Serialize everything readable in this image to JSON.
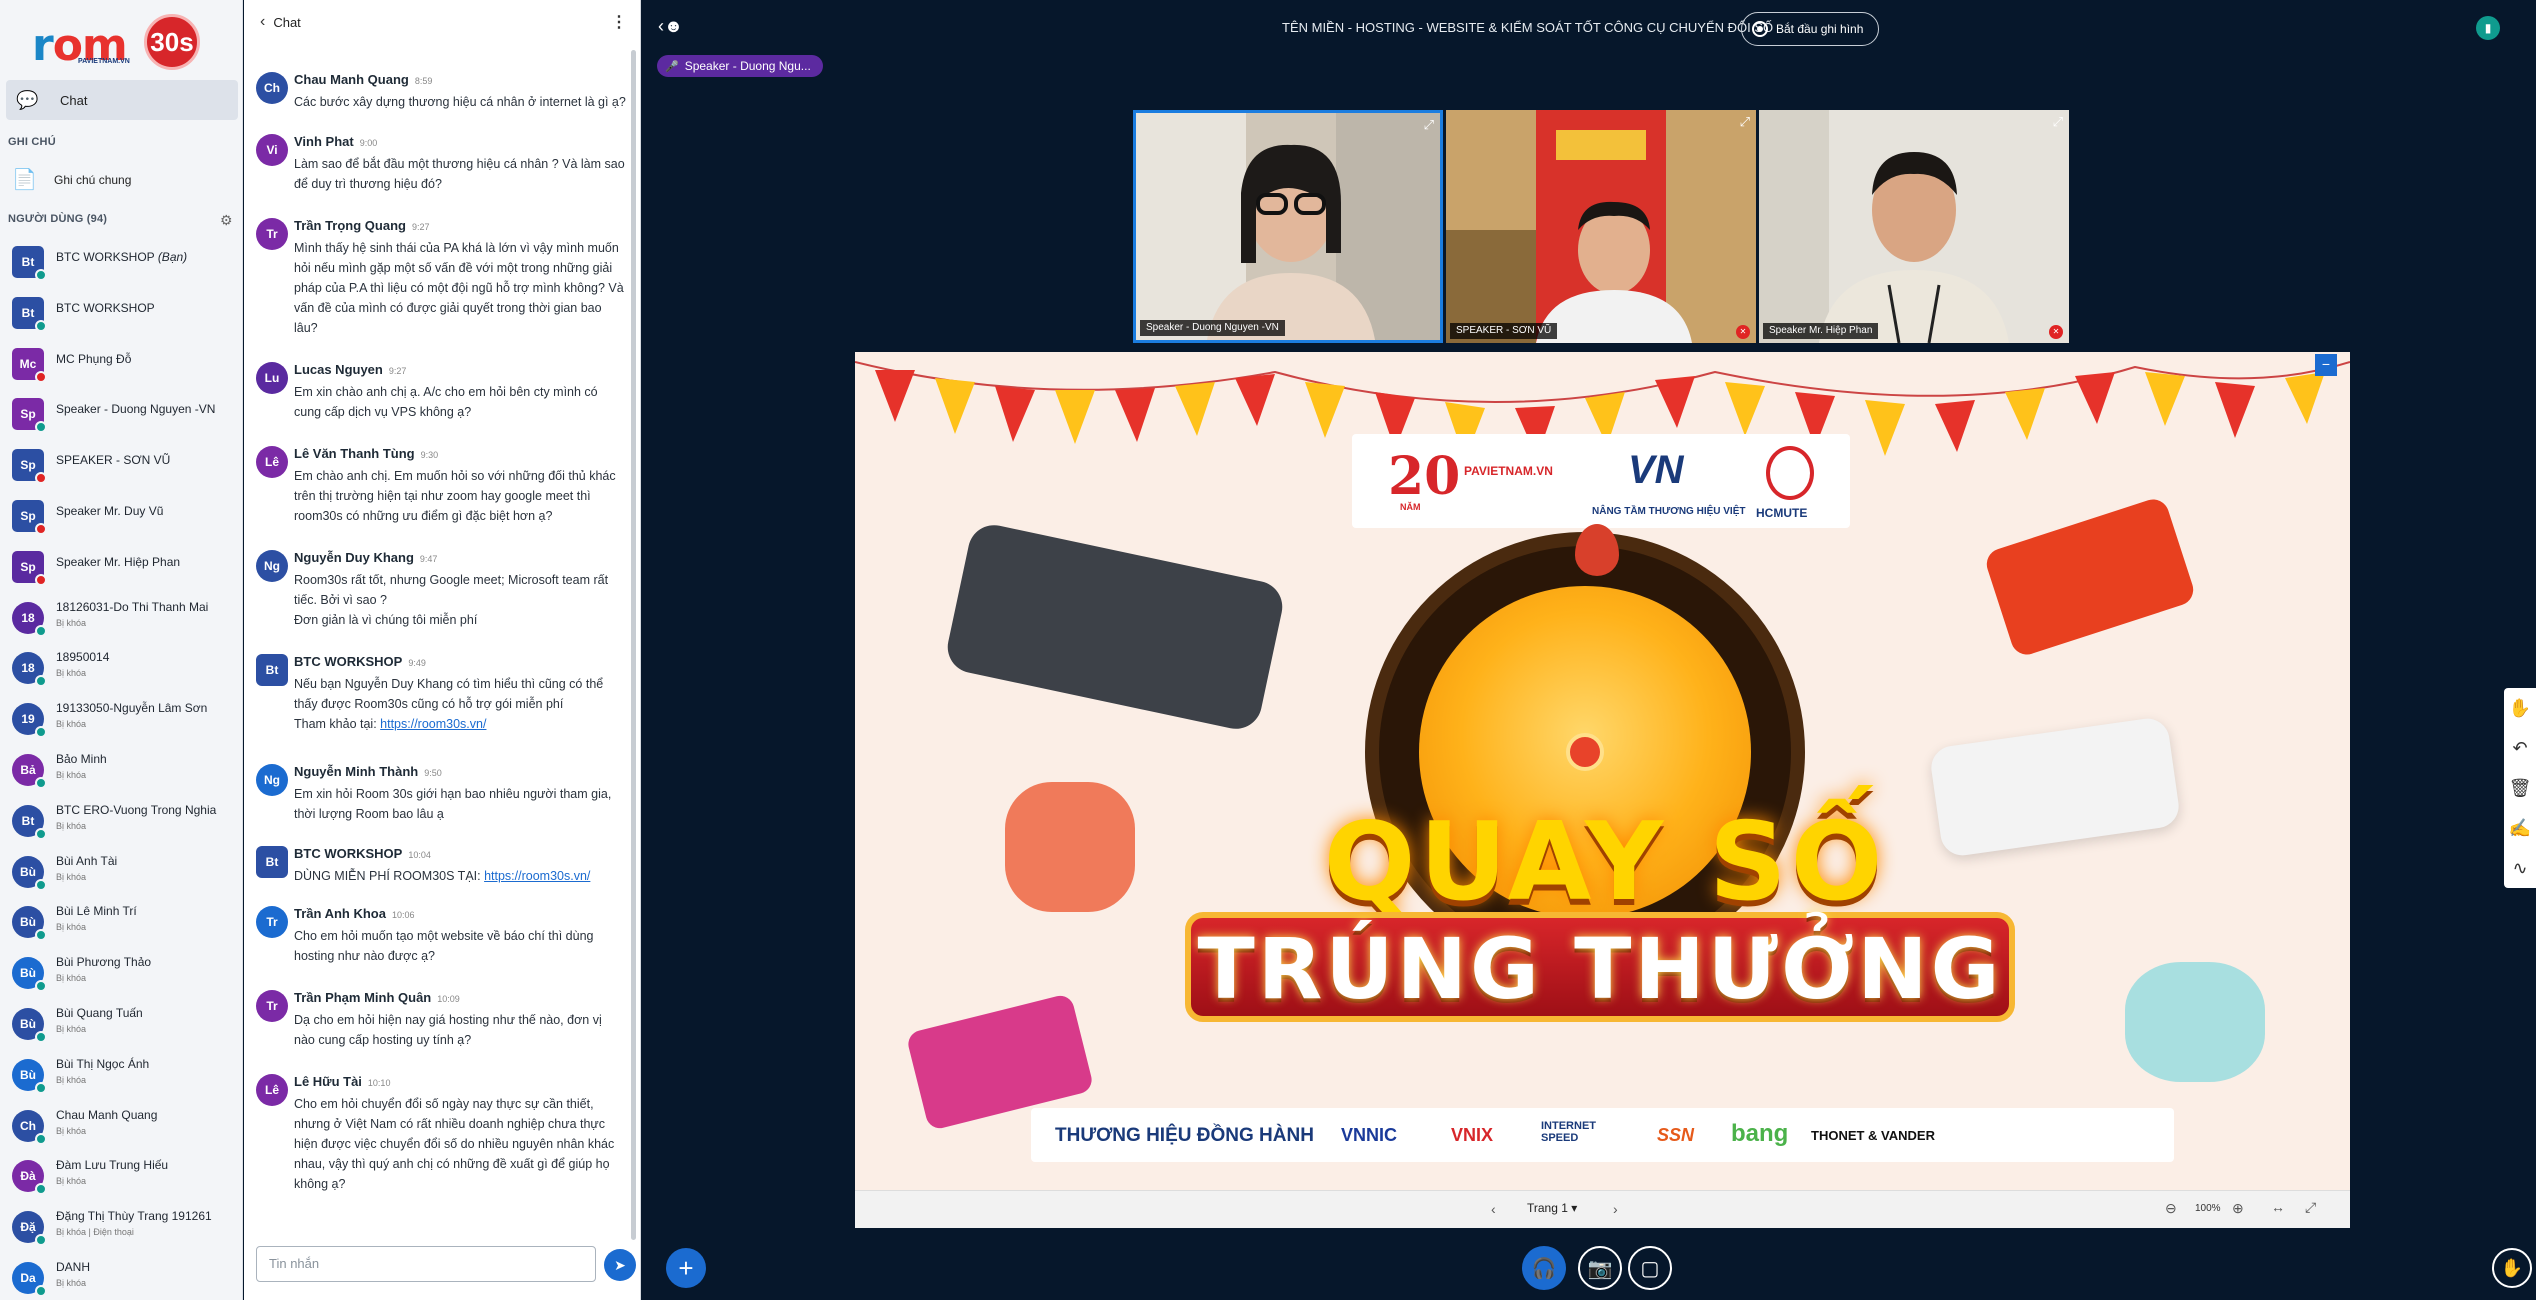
{
  "brand": {
    "name_room": "r",
    "name_rest": "om",
    "badge": "30s",
    "sub": "PAVIETNAM.VN"
  },
  "nav": {
    "chat_label": "Chat"
  },
  "sections": {
    "notes_header": "GHI CHÚ",
    "shared_notes": "Ghi chú chung",
    "users_header": "NGƯỜI DÙNG (94)"
  },
  "users": [
    {
      "initials": "Bt",
      "name": "BTC WORKSHOP",
      "suffix": "(Bạn)",
      "sub": "",
      "color": "#2c4fa3",
      "round": false,
      "status": "#0f9b8e"
    },
    {
      "initials": "Bt",
      "name": "BTC WORKSHOP",
      "suffix": "",
      "sub": "",
      "color": "#2c4fa3",
      "round": false,
      "status": "#0f9b8e"
    },
    {
      "initials": "Mc",
      "name": "MC Phụng Đỗ",
      "suffix": "",
      "sub": "",
      "color": "#7b2aa6",
      "round": false,
      "status": "#e02424"
    },
    {
      "initials": "Sp",
      "name": "Speaker - Duong Nguyen -VN",
      "suffix": "",
      "sub": "",
      "color": "#7b2aa6",
      "round": false,
      "status": "#0f9b8e"
    },
    {
      "initials": "Sp",
      "name": "SPEAKER - SƠN VŨ",
      "suffix": "",
      "sub": "",
      "color": "#2c4fa3",
      "round": false,
      "status": "#e02424"
    },
    {
      "initials": "Sp",
      "name": "Speaker Mr. Duy Vũ",
      "suffix": "",
      "sub": "",
      "color": "#2c4fa3",
      "round": false,
      "status": "#e02424"
    },
    {
      "initials": "Sp",
      "name": "Speaker Mr. Hiệp Phan",
      "suffix": "",
      "sub": "",
      "color": "#5a2aa0",
      "round": false,
      "status": "#e02424"
    },
    {
      "initials": "18",
      "name": "18126031-Do Thi Thanh Mai",
      "suffix": "",
      "sub": "Bị khóa",
      "color": "#5a2aa0",
      "round": true,
      "status": "#0f9b8e"
    },
    {
      "initials": "18",
      "name": "18950014",
      "suffix": "",
      "sub": "Bị khóa",
      "color": "#2c4fa3",
      "round": true,
      "status": "#0f9b8e"
    },
    {
      "initials": "19",
      "name": "19133050-Nguyễn Lâm Sơn",
      "suffix": "",
      "sub": "Bị khóa",
      "color": "#2c4fa3",
      "round": true,
      "status": "#0f9b8e"
    },
    {
      "initials": "Bả",
      "name": "Bảo Minh",
      "suffix": "",
      "sub": "Bị khóa",
      "color": "#7b2aa6",
      "round": true,
      "status": "#0f9b8e"
    },
    {
      "initials": "Bt",
      "name": "BTC ERO-Vuong Trong Nghia",
      "suffix": "",
      "sub": "Bị khóa",
      "color": "#2c4fa3",
      "round": true,
      "status": "#0f9b8e"
    },
    {
      "initials": "Bù",
      "name": "Bùi Anh Tài",
      "suffix": "",
      "sub": "Bị khóa",
      "color": "#2c4fa3",
      "round": true,
      "status": "#0f9b8e"
    },
    {
      "initials": "Bù",
      "name": "Bùi Lê Minh Trí",
      "suffix": "",
      "sub": "Bị khóa",
      "color": "#2c4fa3",
      "round": true,
      "status": "#0f9b8e"
    },
    {
      "initials": "Bù",
      "name": "Bùi Phương Thảo",
      "suffix": "",
      "sub": "Bị khóa",
      "color": "#1b6bd0",
      "round": true,
      "status": "#0f9b8e"
    },
    {
      "initials": "Bù",
      "name": "Bùi Quang Tuấn",
      "suffix": "",
      "sub": "Bị khóa",
      "color": "#2c4fa3",
      "round": true,
      "status": "#0f9b8e"
    },
    {
      "initials": "Bù",
      "name": "Bùi Thị Ngọc Ánh",
      "suffix": "",
      "sub": "Bị khóa",
      "color": "#1b6bd0",
      "round": true,
      "status": "#0f9b8e"
    },
    {
      "initials": "Ch",
      "name": "Chau Manh Quang",
      "suffix": "",
      "sub": "Bị khóa",
      "color": "#2c4fa3",
      "round": true,
      "status": "#0f9b8e"
    },
    {
      "initials": "Đà",
      "name": "Đàm Lưu Trung Hiếu",
      "suffix": "",
      "sub": "Bị khóa",
      "color": "#7b2aa6",
      "round": true,
      "status": "#0f9b8e"
    },
    {
      "initials": "Đặ",
      "name": "Đặng Thị Thùy Trang 191261",
      "suffix": "",
      "sub": "Bị khóa | Điện thoại",
      "color": "#2c4fa3",
      "round": true,
      "status": "#0f9b8e"
    },
    {
      "initials": "Da",
      "name": "DANH",
      "suffix": "",
      "sub": "Bị khóa",
      "color": "#1b6bd0",
      "round": true,
      "status": "#0f9b8e"
    }
  ],
  "chat": {
    "title": "Chat",
    "input_placeholder": "Tin nhắn",
    "messages": [
      {
        "initials": "Ch",
        "name": "Chau Manh Quang",
        "time": "8:59",
        "color": "#2c4fa3",
        "square": false,
        "lines": [
          "Các bước xây dựng thương hiệu cá nhân ở internet là gì ạ?"
        ],
        "h": 62
      },
      {
        "initials": "Vi",
        "name": "Vinh Phat",
        "time": "9:00",
        "color": "#7b2aa6",
        "square": false,
        "lines": [
          "Làm sao để bắt đầu một thương hiệu cá nhân ? Và làm sao để duy trì thương hiệu đó?"
        ],
        "h": 84
      },
      {
        "initials": "Tr",
        "name": "Trần Trọng Quang",
        "time": "9:27",
        "color": "#7b2aa6",
        "square": false,
        "lines": [
          "Mình thấy hệ sinh thái của PA khá là lớn vì vậy mình muốn hỏi nếu mình gặp một số vấn đề với một trong những giải pháp của P.A thì liệu có một đội ngũ hỗ trợ mình không? Và vấn đề của mình có được giải quyết trong thời gian bao lâu?"
        ],
        "h": 144
      },
      {
        "initials": "Lu",
        "name": "Lucas Nguyen",
        "time": "9:27",
        "color": "#5a2aa0",
        "square": false,
        "lines": [
          "Em xin chào anh chị ạ. A/c cho em hỏi bên cty mình có cung cấp dịch vụ VPS không ạ?"
        ],
        "h": 84
      },
      {
        "initials": "Lê",
        "name": "Lê Văn Thanh Tùng",
        "time": "9:30",
        "color": "#7b2aa6",
        "square": false,
        "lines": [
          "Em chào anh chị. Em muốn hỏi so với những đối thủ khác trên thị trường hiện tại như zoom hay google meet thì room30s có những ưu điểm gì đặc biệt hơn ạ?"
        ],
        "h": 104
      },
      {
        "initials": "Ng",
        "name": "Nguyễn Duy Khang",
        "time": "9:47",
        "color": "#2c4fa3",
        "square": false,
        "lines": [
          "Room30s rất tốt, nhưng Google meet; Microsoft team rất tiếc. Bởi vì sao ?",
          "Đơn giản là vì chúng tôi miễn phí"
        ],
        "h": 104
      },
      {
        "initials": "Bt",
        "name": "BTC WORKSHOP",
        "time": "9:49",
        "color": "#2c4fa3",
        "square": true,
        "lines": [
          "Nếu bạn Nguyễn Duy Khang có tìm hiểu thì cũng có thể thấy được Room30s cũng có hỗ trợ gói miễn phí"
        ],
        "link_prefix": "Tham khảo tại: ",
        "link": "https://room30s.vn/",
        "h": 110
      },
      {
        "initials": "Ng",
        "name": "Nguyễn Minh Thành",
        "time": "9:50",
        "color": "#1b6bd0",
        "square": false,
        "lines": [
          "Em xin hỏi Room 30s giới hạn bao nhiêu người tham gia, thời lượng Room bao lâu ạ"
        ],
        "h": 82
      },
      {
        "initials": "Bt",
        "name": "BTC WORKSHOP",
        "time": "10:04",
        "color": "#2c4fa3",
        "square": true,
        "lines": [],
        "link_prefix": "DÙNG MIỄN PHÍ ROOM30S TẠI: ",
        "link": "https://room30s.vn/",
        "h": 60
      },
      {
        "initials": "Tr",
        "name": "Trần Anh Khoa",
        "time": "10:06",
        "color": "#1b6bd0",
        "square": false,
        "lines": [
          "Cho em hỏi muốn tạo một website về báo chí thì dùng hosting như nào được ạ?"
        ],
        "h": 84
      },
      {
        "initials": "Tr",
        "name": "Trần Phạm Minh Quân",
        "time": "10:09",
        "color": "#7b2aa6",
        "square": false,
        "lines": [
          "Dạ cho em hỏi hiện nay giá hosting như thế nào, đơn vị nào cung cấp hosting uy tính ạ?"
        ],
        "h": 84
      },
      {
        "initials": "Lê",
        "name": "Lê Hữu Tài",
        "time": "10:10",
        "color": "#7b2aa6",
        "square": false,
        "lines": [
          "Cho em hỏi chuyển đổi số ngày nay thực sự cần thiết, nhưng ở Việt Nam có rất nhiều doanh nghiệp chưa thực hiện được việc chuyển đổi số do nhiều nguyên nhân khác nhau, vậy thì quý anh chị có những đề xuất gì để giúp họ không ạ?"
        ],
        "h": 124
      }
    ]
  },
  "stage": {
    "title": "TÊN MIỀN - HOSTING - WEBSITE & KIỂM SOÁT TỐT CÔNG CỤ CHUYỂN ĐỔI SỐ",
    "record_label": "Bắt đầu ghi hình",
    "talking": "Speaker - Duong Ngu...",
    "videos": [
      {
        "label": "Speaker - Duong Nguyen -VN",
        "active": true,
        "muted": false
      },
      {
        "label": "SPEAKER - SƠN VŨ",
        "active": false,
        "muted": true
      },
      {
        "label": "Speaker Mr. Hiệp Phan",
        "active": false,
        "muted": true
      }
    ],
    "slide_page": "Trang 1",
    "zoom": "100%"
  },
  "slide": {
    "title1": "QUAY SỐ",
    "title2": "TRÚNG THƯỞNG",
    "partners_heading": "THƯƠNG HIỆU ĐỒNG HÀNH",
    "partners": [
      "VNNIC",
      "VNIX",
      "INTERNET SPEED",
      "SSN",
      "bang",
      "THONET & VANDER"
    ],
    "logo_20": "20",
    "logo_20_sub": "NĂM",
    "logo_pavietnam": "PAVIETNAM.VN",
    "logo_vn": "VN",
    "logo_vn_sub": "NÂNG TẦM THƯƠNG HIỆU VIỆT",
    "logo_hcmute": "HCMUTE"
  },
  "colors": {
    "accent": "#1b6bd0",
    "teal": "#0f9b8e",
    "purple": "#5c2aa0",
    "dark": "#06172b",
    "red": "#e02424"
  }
}
